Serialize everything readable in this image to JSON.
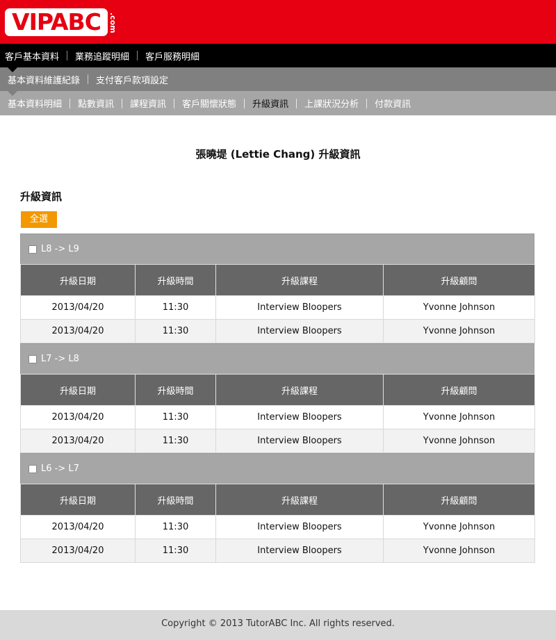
{
  "logo": {
    "main": "VIPABC",
    "suffix": ".com"
  },
  "nav_primary": [
    "客戶基本資料",
    "業務追蹤明細",
    "客戶服務明細"
  ],
  "nav_secondary": [
    "基本資料維護紀錄",
    "支付客戶款項設定"
  ],
  "nav_tertiary": [
    "基本資料明細",
    "點數資訊",
    "課程資訊",
    "客戶關懷狀態",
    "升級資訊",
    "上課狀況分析",
    "付款資訊"
  ],
  "page_title": "張曉堤 (Lettie Chang) 升級資訊",
  "section_title": "升級資訊",
  "select_all_label": "全選",
  "columns": [
    "升級日期",
    "升級時間",
    "升級課程",
    "升級顧問"
  ],
  "groups": [
    {
      "label": "L8 -> L9",
      "rows": [
        [
          "2013/04/20",
          "11:30",
          "Interview Bloopers",
          "Yvonne Johnson"
        ],
        [
          "2013/04/20",
          "11:30",
          "Interview Bloopers",
          "Yvonne Johnson"
        ]
      ]
    },
    {
      "label": "L7 -> L8",
      "rows": [
        [
          "2013/04/20",
          "11:30",
          "Interview Bloopers",
          "Yvonne Johnson"
        ],
        [
          "2013/04/20",
          "11:30",
          "Interview Bloopers",
          "Yvonne Johnson"
        ]
      ]
    },
    {
      "label": "L6 -> L7",
      "rows": [
        [
          "2013/04/20",
          "11:30",
          "Interview Bloopers",
          "Yvonne Johnson"
        ],
        [
          "2013/04/20",
          "11:30",
          "Interview Bloopers",
          "Yvonne Johnson"
        ]
      ]
    }
  ],
  "footer": "Copyright © 2013 TutorABC Inc. All rights reserved.",
  "colors": {
    "brand_red": "#e60012",
    "accent_orange": "#f39800",
    "header_gray": "#666666"
  }
}
